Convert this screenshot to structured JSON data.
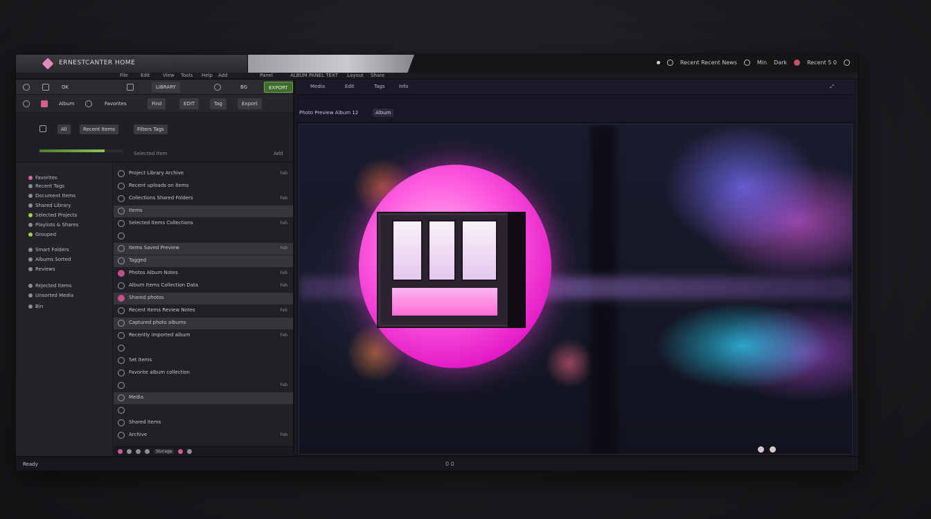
{
  "window": {
    "title": "ERNESTCANTER  HOME",
    "right_items": [
      "Recent  Recent  News",
      "Min",
      "Dark",
      "Recent 5 0"
    ]
  },
  "menu": [
    "File",
    "Edit",
    "View",
    "Tools",
    "Help",
    "Add",
    "Panel",
    "ALBUM PANEL TEXT",
    "Layout",
    "Share"
  ],
  "left_toolbar": {
    "buttons": [
      "OK",
      "LIBRARY",
      "BG",
      "EXPORT",
      "EDIT"
    ],
    "row2": [
      "Album",
      "Favorites",
      "Find",
      "Tag",
      "Export"
    ]
  },
  "filters": {
    "chips": [
      "All",
      "Recent  Items",
      "Filters  Tags"
    ],
    "hint": "Selected Item",
    "label": "Add",
    "progress": 0.78
  },
  "sidebar": [
    {
      "label": "Favorites",
      "dot": "pink"
    },
    {
      "label": "Recent Tags",
      "dot": "grey"
    },
    {
      "label": "Document Items",
      "dot": "grey"
    },
    {
      "label": "Shared Library",
      "dot": "grey"
    },
    {
      "label": "Selected Projects",
      "dot": "green"
    },
    {
      "label": "Playlists & Shares",
      "dot": "grey"
    },
    {
      "label": "Grouped",
      "dot": "green"
    },
    {
      "label": "Smart Folders",
      "dot": "grey"
    },
    {
      "label": "Albums Sorted",
      "dot": "grey"
    },
    {
      "label": "Reviews",
      "dot": "grey"
    },
    {
      "label": "Rejected Items",
      "dot": "grey"
    },
    {
      "label": "Unsorted Media",
      "dot": "grey"
    },
    {
      "label": "Bin",
      "dot": "grey"
    }
  ],
  "list": [
    {
      "text": "Project Library Archive",
      "meta": "Feb",
      "sel": false,
      "icon": "grey"
    },
    {
      "text": "Recent uploads on items",
      "meta": "",
      "sel": false,
      "icon": "grey"
    },
    {
      "text": "Collections Shared Folders",
      "meta": "Feb",
      "sel": false,
      "icon": "grey"
    },
    {
      "text": "Items",
      "meta": "",
      "sel": true,
      "icon": "grey"
    },
    {
      "text": "Selected Items Collections",
      "meta": "Feb",
      "sel": false,
      "icon": "grey"
    },
    {
      "text": "",
      "meta": "",
      "sel": false,
      "icon": "grey"
    },
    {
      "text": "Items Saved Preview",
      "meta": "Feb",
      "sel": true,
      "icon": "grey"
    },
    {
      "text": "Tagged",
      "meta": "",
      "sel": true,
      "icon": "grey"
    },
    {
      "text": "Photos Album Notes",
      "meta": "Feb",
      "sel": false,
      "icon": "pink"
    },
    {
      "text": "Album Items Collection Data",
      "meta": "Feb",
      "sel": false,
      "icon": "grey"
    },
    {
      "text": "Shared photos",
      "meta": "",
      "sel": true,
      "icon": "pink"
    },
    {
      "text": "Recent Items Review Notes",
      "meta": "Feb",
      "sel": false,
      "icon": "grey"
    },
    {
      "text": "Captured photo albums",
      "meta": "",
      "sel": true,
      "icon": "grey"
    },
    {
      "text": "Recently imported album",
      "meta": "Feb",
      "sel": false,
      "icon": "grey"
    },
    {
      "text": "",
      "meta": "",
      "sel": false,
      "icon": "grey"
    },
    {
      "text": "Set items",
      "meta": "",
      "sel": false,
      "icon": "grey"
    },
    {
      "text": "Favorite album collection",
      "meta": "",
      "sel": false,
      "icon": "grey"
    },
    {
      "text": "",
      "meta": "Feb",
      "sel": false,
      "icon": "grey"
    },
    {
      "text": "Media",
      "meta": "",
      "sel": true,
      "icon": "grey"
    },
    {
      "text": "",
      "meta": "",
      "sel": false,
      "icon": "grey"
    },
    {
      "text": "Shared items",
      "meta": "",
      "sel": false,
      "icon": "grey"
    },
    {
      "text": "Archive",
      "meta": "Feb",
      "sel": false,
      "icon": "grey"
    }
  ],
  "list_footer": "Storage",
  "right_toolbar": [
    "Media",
    "Edit",
    "Tags",
    "Info"
  ],
  "breadcrumb": {
    "path": "Photo Preview Album 12",
    "tab": "Album"
  },
  "viewer": {
    "caption": "0 0"
  },
  "statusbar": {
    "left": "Ready",
    "mid": ""
  },
  "colors": {
    "accent": "#e31ac6",
    "green": "#6ea54c",
    "bg": "#1a1a1e"
  }
}
